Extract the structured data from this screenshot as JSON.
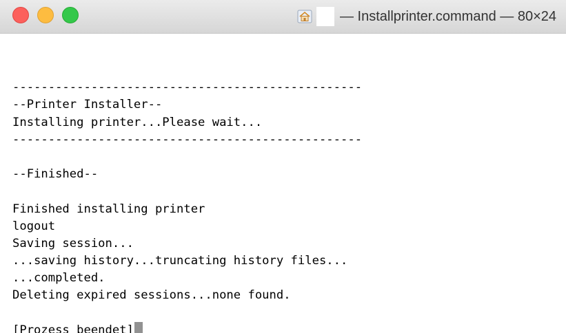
{
  "window": {
    "title": "— Installprinter.command — 80×24",
    "icons": {
      "home": "home-folder-icon"
    },
    "colors": {
      "close": "#fc605c",
      "minimize": "#fdbc40",
      "zoom": "#34c84a"
    }
  },
  "terminal": {
    "lines": [
      "",
      "-------------------------------------------------",
      "--Printer Installer--",
      "Installing printer...Please wait...",
      "-------------------------------------------------",
      "",
      "--Finished--",
      "",
      "Finished installing printer",
      "logout",
      "Saving session...",
      "...saving history...truncating history files...",
      "...completed.",
      "Deleting expired sessions...none found.",
      "",
      "[Prozess beendet]"
    ]
  }
}
